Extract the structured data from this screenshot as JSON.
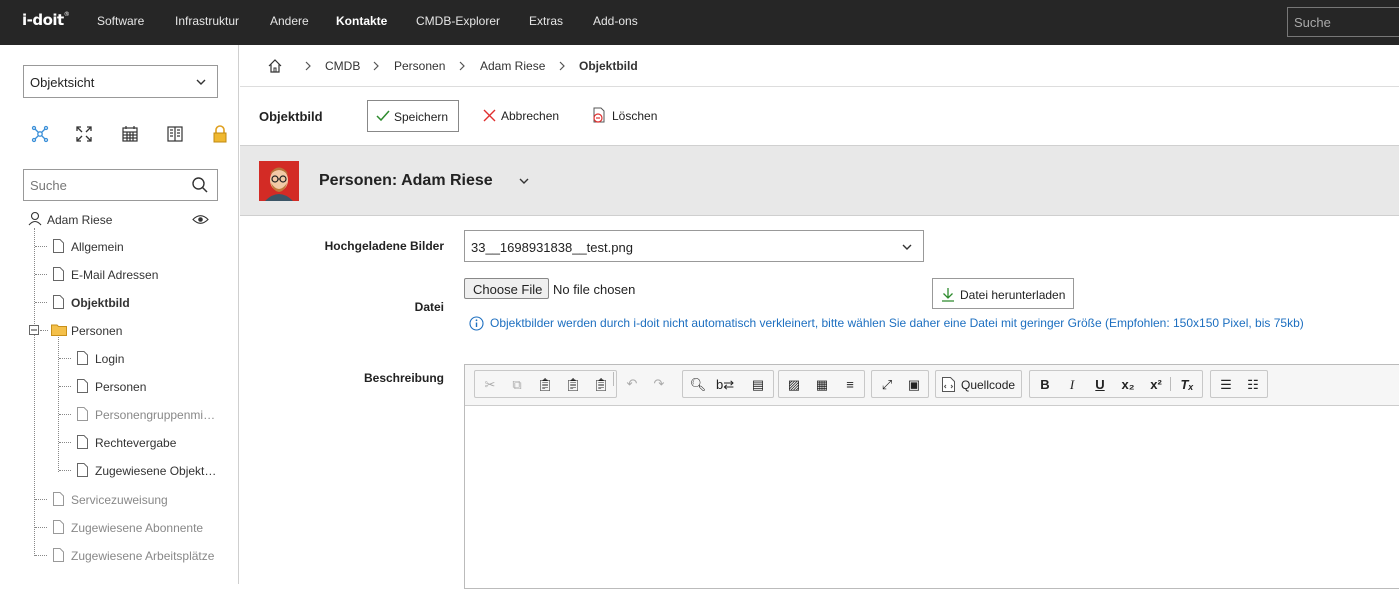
{
  "topnav": {
    "logo": "i-doit",
    "items": [
      "Software",
      "Infrastruktur",
      "Andere",
      "Kontakte",
      "CMDB-Explorer",
      "Extras",
      "Add-ons"
    ],
    "active": "Kontakte",
    "search_placeholder": "Suche"
  },
  "sidebar": {
    "view_select": "Objektsicht",
    "search_placeholder": "Suche",
    "root": "Adam Riese",
    "items": [
      "Allgemein",
      "E-Mail Adressen",
      "Objektbild",
      "Personen"
    ],
    "folder_children": [
      "Login",
      "Personen",
      "Personengruppenmi…",
      "Rechtevergabe",
      "Zugewiesene Objekt…"
    ],
    "bottom_items": [
      "Servicezuweisung",
      "Zugewiesene Abonnente",
      "Zugewiesene Arbeitsplätze"
    ]
  },
  "breadcrumb": [
    "CMDB",
    "Personen",
    "Adam Riese",
    "Objektbild"
  ],
  "actionbar": {
    "title": "Objektbild",
    "save": "Speichern",
    "cancel": "Abbrechen",
    "delete": "Löschen"
  },
  "object": {
    "title": "Personen: Adam Riese"
  },
  "form": {
    "uploaded_label": "Hochgeladene Bilder",
    "uploaded_value": "33__1698931838__test.png",
    "file_label": "Datei",
    "choose_file": "Choose File",
    "no_file": "No file chosen",
    "download": "Datei herunterladen",
    "hint": "Objektbilder werden durch i-doit nicht automatisch verkleinert, bitte wählen Sie daher eine Datei mit geringer Größe (Empfohlen: 150x150 Pixel, bis 75kb)",
    "description_label": "Beschreibung",
    "source_button": "Quellcode"
  },
  "colors": {
    "topbar": "#262626",
    "hint_blue": "#1d6fc0",
    "avatar_red": "#d32b25",
    "cancel_red": "#e03030",
    "save_green": "#2e8b2e"
  }
}
